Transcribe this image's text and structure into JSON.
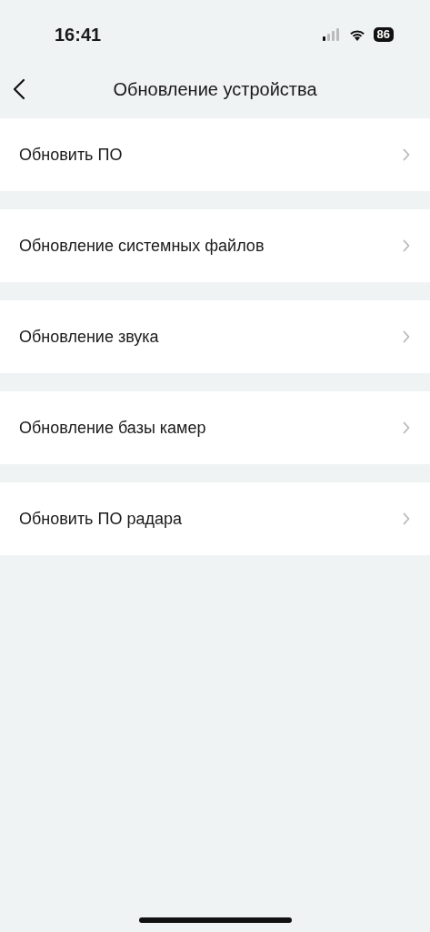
{
  "status_bar": {
    "time": "16:41",
    "battery": "86"
  },
  "nav": {
    "title": "Обновление устройства"
  },
  "items": [
    {
      "label": "Обновить ПО"
    },
    {
      "label": "Обновление системных файлов"
    },
    {
      "label": "Обновление звука"
    },
    {
      "label": "Обновление базы камер"
    },
    {
      "label": "Обновить ПО радара"
    }
  ]
}
